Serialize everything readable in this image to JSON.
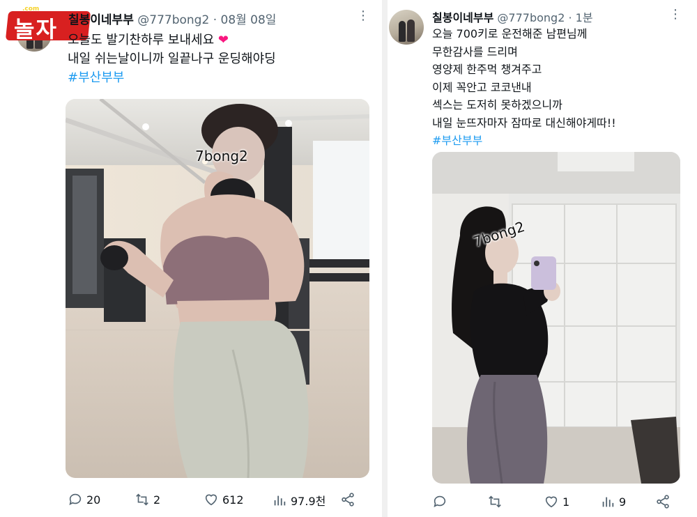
{
  "site_logo": {
    "text": "놀자",
    "sub": ".com"
  },
  "tweets": [
    {
      "name": "칠봉이네부부",
      "handle": "@777bong2",
      "dot": "·",
      "time": "08월 08일",
      "lines": [
        "오늘도 발기찬하루 보내세요",
        "내일 쉬는날이니까 일끝나구 운딩해야딩"
      ],
      "heart_emoji": "❤",
      "hashtag": "#부산부부",
      "watermark": "7bong2",
      "replies": "20",
      "retweets": "2",
      "likes": "612",
      "views": "97.9천"
    },
    {
      "name": "칠봉이네부부",
      "handle": "@777bong2",
      "dot": "·",
      "time": "1분",
      "lines": [
        "오늘 700키로 운전해준 남편님께",
        "무한감사를 드리며",
        "영양제 한주먹 챙겨주고",
        "이제 꼭안고 코코낸내",
        "섹스는 도저히 못하겠으니까",
        "내일 눈뜨자마자 잠따로 대신해야게따!!"
      ],
      "hashtag": "#부산부부",
      "watermark": "7bong2",
      "replies": "",
      "retweets": "",
      "likes": "1",
      "views": "9"
    }
  ],
  "colors": {
    "hashtag": "#1d9bf0",
    "secondary": "#536471",
    "heart": "#f91880",
    "logo_red": "#d82020"
  }
}
